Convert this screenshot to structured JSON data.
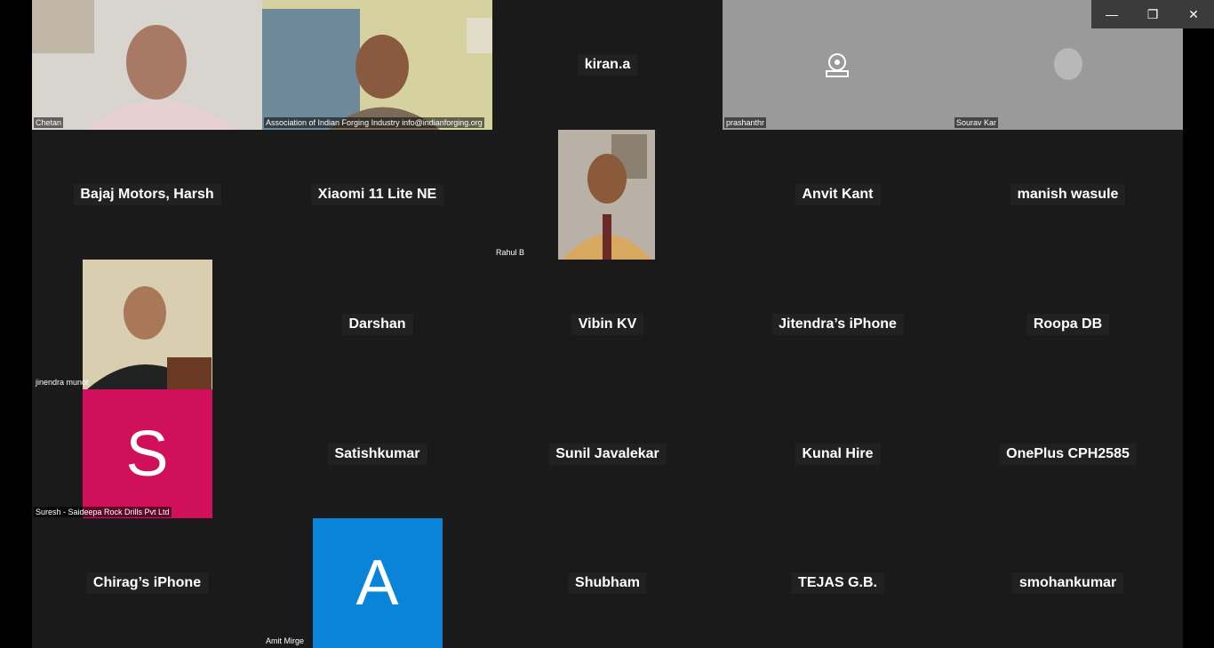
{
  "window": {
    "controls": {
      "minimize": "—",
      "restore": "❐",
      "close": "✕"
    }
  },
  "tiles": {
    "chetan": "Chetan",
    "aiia": "Association of Indian Forging Industry info@indianforging.org",
    "kiran": "kiran.a",
    "prashanthr": "prashanthr",
    "sourav": "Sourav Kar",
    "bajaj": "Bajaj Motors, Harsh",
    "xiaomi": "Xiaomi 11 Lite NE",
    "rahul": "Rahul B",
    "anvit": "Anvit Kant",
    "manish": "manish wasule",
    "jinendra": "jinendra munot",
    "darshan": "Darshan",
    "vibin": "Vibin KV",
    "jitendra": "Jitendra’s iPhone",
    "roopa": "Roopa DB",
    "suresh": "Suresh - Saideepa Rock Drills Pvt Ltd",
    "suresh_letter": "S",
    "satish": "Satishkumar",
    "sunil": "Sunil Javalekar",
    "kunal": "Kunal Hire",
    "oneplus": "OnePlus CPH2585",
    "chirag": "Chirag’s iPhone",
    "amit": "Amit Mirge",
    "amit_letter": "A",
    "shubham": "Shubham",
    "tejas": "TEJAS G.B.",
    "smohan": "smohankumar"
  },
  "colors": {
    "tile_bg": "#1a1a1a",
    "suresh_avatar": "#d0105a",
    "amit_avatar": "#0a84d8"
  }
}
